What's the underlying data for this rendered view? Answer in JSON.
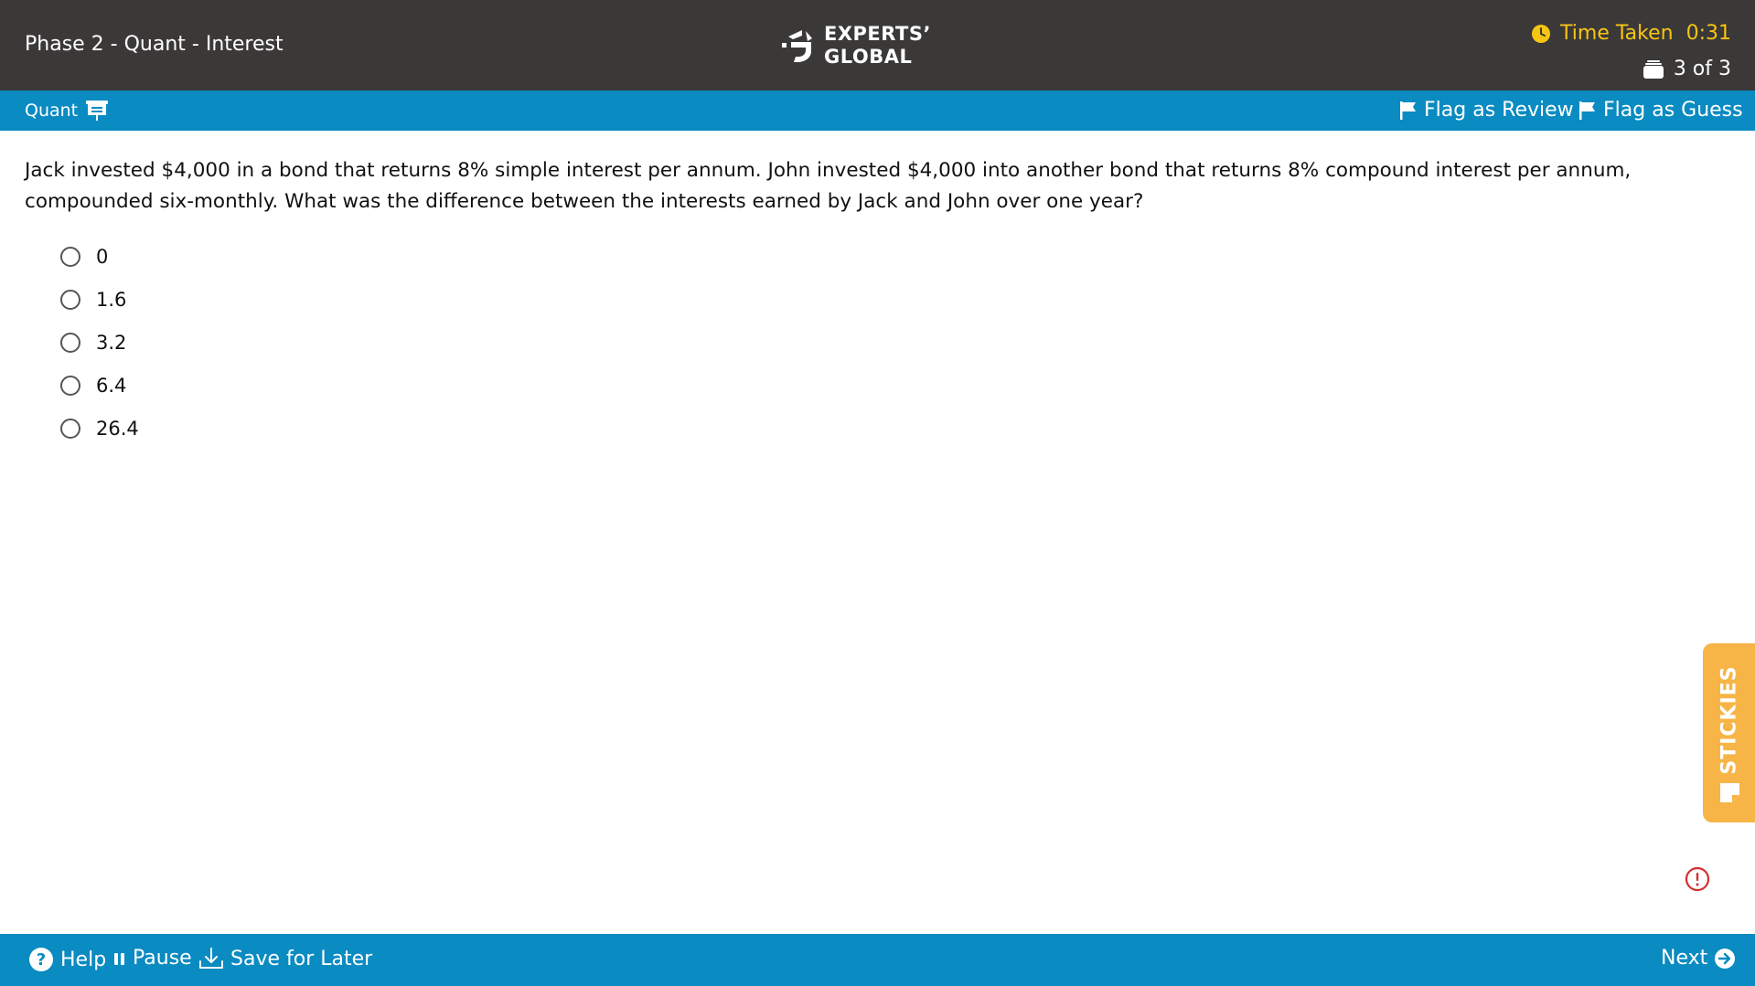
{
  "header": {
    "test_title": "Phase 2 - Quant - Interest",
    "logo_line1": "EXPERTS’",
    "logo_line2": "GLOBAL",
    "time_label": "Time Taken",
    "time_value": "0:31",
    "question_counter": "3 of 3",
    "timer_color": "#f6c514"
  },
  "section_bar": {
    "section_name": "Quant",
    "flag_review_label": "Flag as Review",
    "flag_guess_label": "Flag as Guess"
  },
  "question": {
    "text": "Jack invested $4,000 in a bond that returns 8% simple interest per annum. John invested $4,000 into another bond that returns 8% compound interest per annum, compounded six-monthly. What was the difference between the interests earned by Jack and John over one year?",
    "options": [
      "0",
      "1.6",
      "3.2",
      "6.4",
      "26.4"
    ],
    "selected": null
  },
  "stickies": {
    "label": "STICKIES"
  },
  "footer": {
    "help_label": "Help",
    "pause_label": "Pause",
    "save_label": "Save for Later",
    "next_label": "Next"
  },
  "colors": {
    "header_bg": "#3b3838",
    "bar_blue": "#0a8bc1",
    "stickies_orange": "#f7b547",
    "alert_red": "#d32f2f"
  },
  "icons": [
    "clock-icon",
    "question-stack-icon",
    "whiteboard-icon",
    "flag-icon",
    "sticky-note-icon",
    "report-error-icon",
    "help-icon",
    "pause-icon",
    "download-icon",
    "next-arrow-icon"
  ]
}
